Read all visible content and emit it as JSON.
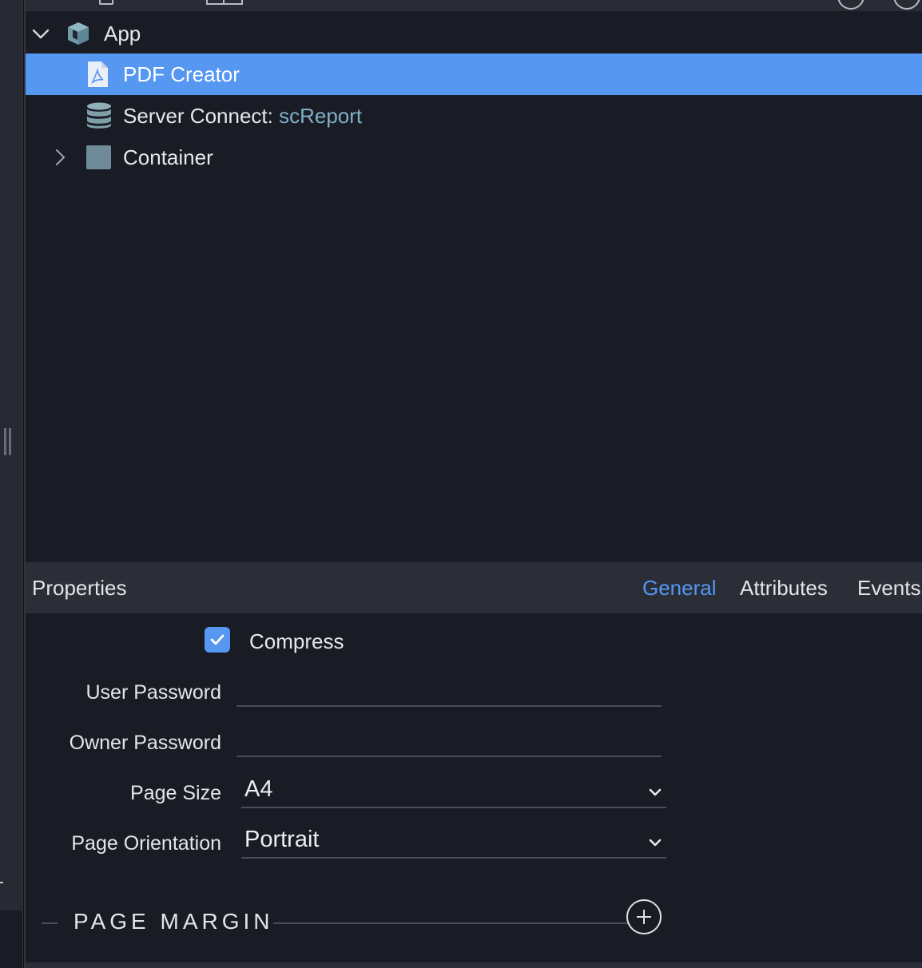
{
  "tree": {
    "items": [
      {
        "label": "App",
        "icon": "cube-icon",
        "expanded": true
      },
      {
        "label": "PDF Creator",
        "icon": "pdf-file-icon",
        "selected": true
      },
      {
        "label": "Server Connect: ",
        "accent": "scReport",
        "icon": "database-icon"
      },
      {
        "label": "Container",
        "icon": "container-icon",
        "expanded": false
      }
    ]
  },
  "properties": {
    "title": "Properties",
    "tabs": [
      {
        "label": "General",
        "active": true
      },
      {
        "label": "Attributes"
      },
      {
        "label": "Events"
      }
    ],
    "compress": {
      "label": "Compress",
      "checked": true
    },
    "user_password": {
      "label": "User Password",
      "value": ""
    },
    "owner_password": {
      "label": "Owner Password",
      "value": ""
    },
    "page_size": {
      "label": "Page Size",
      "value": "A4"
    },
    "page_orientation": {
      "label": "Page Orientation",
      "value": "Portrait"
    },
    "section": {
      "title": "PAGE MARGIN"
    }
  },
  "colors": {
    "selection": "#5597f1",
    "background": "#1a1c25",
    "header": "#2b2d37",
    "accent_text": "#7fb0c8"
  }
}
